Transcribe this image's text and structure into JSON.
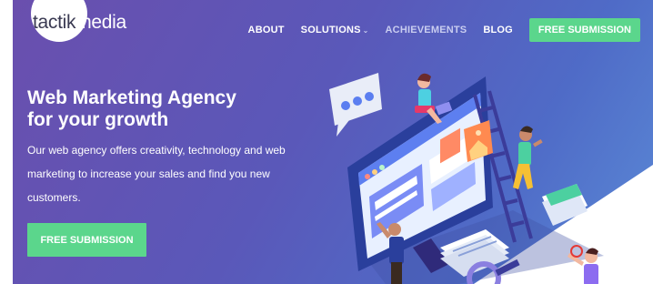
{
  "logo": {
    "part1": "tactik",
    "part2": "media"
  },
  "nav": {
    "items": [
      "ABOUT",
      "SOLUTIONS",
      "ACHIEVEMENTS",
      "BLOG"
    ],
    "solutions_chevron": "chevron-down-icon",
    "cta": "FREE SUBMISSION"
  },
  "hero": {
    "headline_line1": "Web Marketing Agency",
    "headline_line2": "for your growth",
    "subtext": "Our web agency offers creativity, technology and web marketing to increase your sales and find you new customers.",
    "cta": "FREE SUBMISSION"
  },
  "colors": {
    "accent_green": "#5bd68c",
    "hero_gradient_start": "#6a4fae",
    "hero_gradient_end": "#5b8ad6"
  }
}
